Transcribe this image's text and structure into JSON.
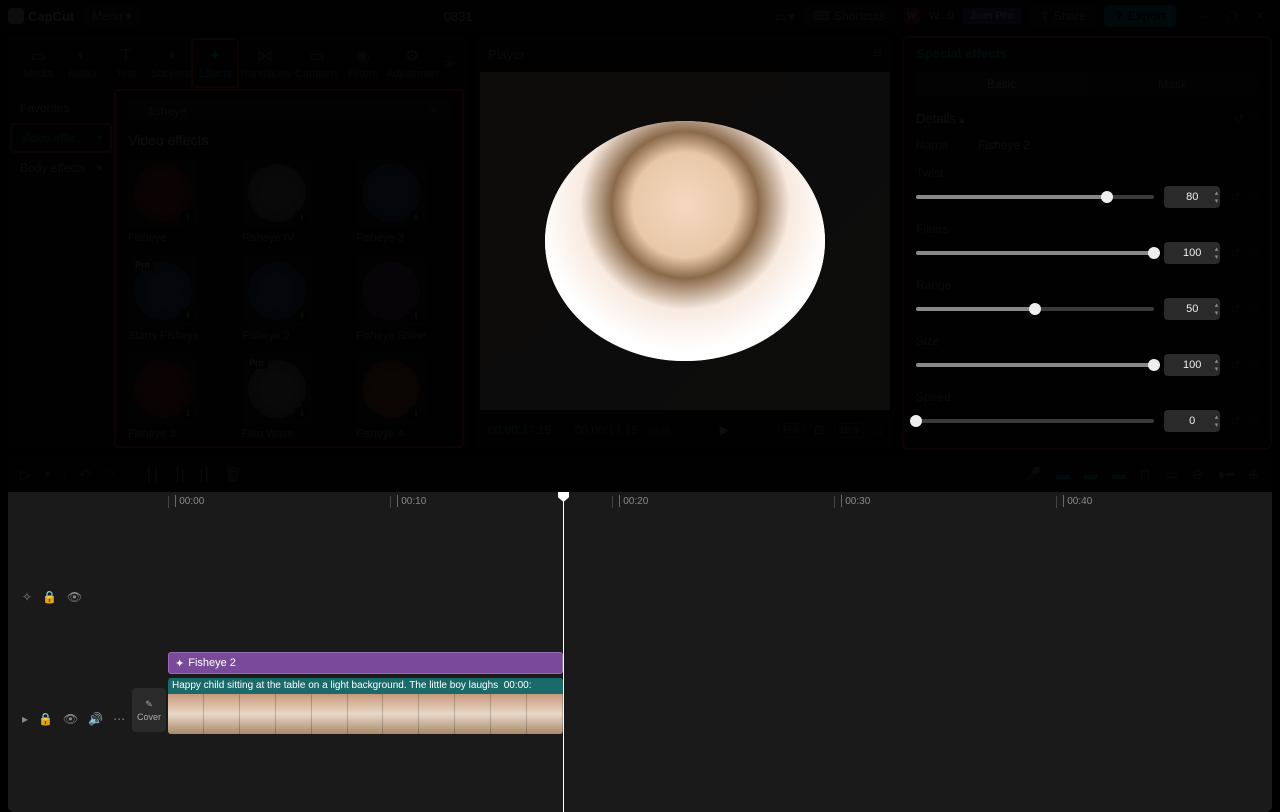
{
  "titlebar": {
    "app": "CapCut",
    "menu": "Menu",
    "project": "0831",
    "shortcuts": "Shortcuts",
    "user_initial": "W",
    "user_name": "W...0",
    "join_pro": "Join Pro",
    "share": "Share",
    "export": "Export"
  },
  "tabs": [
    "Media",
    "Audio",
    "Text",
    "Stickers",
    "Effects",
    "Transitions",
    "Captions",
    "Filters",
    "Adjustmen"
  ],
  "tab_icons": [
    "▭",
    "◐",
    "T",
    "◑",
    "✦",
    "⋈",
    "▭",
    "◉",
    "⚙"
  ],
  "active_tab": "Effects",
  "sidebar": {
    "favorites": "Favorites",
    "video_effects": "Video effe...",
    "body_effects": "Body effects"
  },
  "search": {
    "placeholder": "",
    "value": "fisheye"
  },
  "effects_section": "Video effects",
  "effects": [
    {
      "label": "Fisheye",
      "pro": false,
      "color": "red"
    },
    {
      "label": "Fisheye IV",
      "pro": false,
      "color": "grey"
    },
    {
      "label": "Fisheye 3",
      "pro": false,
      "color": "blue"
    },
    {
      "label": "Starry Fisheye",
      "pro": true,
      "color": "blue"
    },
    {
      "label": "Fisheye 2",
      "pro": false,
      "color": "blue"
    },
    {
      "label": "Fisheye Shine",
      "pro": false,
      "color": "purple"
    },
    {
      "label": "Fisheye 3",
      "pro": false,
      "color": "red"
    },
    {
      "label": "Film Wave",
      "pro": true,
      "color": "grey"
    },
    {
      "label": "Fisheye 4",
      "pro": false,
      "color": "orange"
    }
  ],
  "player": {
    "title": "Player",
    "current": "00:00:17:15",
    "duration": "00:00:17:15",
    "full": "Full",
    "ratio": "16:9"
  },
  "inspector": {
    "title": "Special effects",
    "tab_basic": "Basic",
    "tab_mask": "Mask",
    "details": "Details",
    "name_label": "Name",
    "name_value": "Fisheye 2",
    "params": [
      {
        "label": "Twist",
        "value": 80,
        "max": 100
      },
      {
        "label": "Filters",
        "value": 100,
        "max": 100
      },
      {
        "label": "Range",
        "value": 50,
        "max": 100
      },
      {
        "label": "Size",
        "value": 100,
        "max": 100
      },
      {
        "label": "Speed",
        "value": 0,
        "max": 100
      }
    ]
  },
  "timeline": {
    "ticks": [
      "00:00",
      "00:10",
      "00:20",
      "00:30",
      "00:40"
    ],
    "effect_clip": "Fisheye 2",
    "video_label": "Happy child sitting at the table on a light background. The little boy laughs",
    "video_tc": "00:00:",
    "cover": "Cover"
  }
}
